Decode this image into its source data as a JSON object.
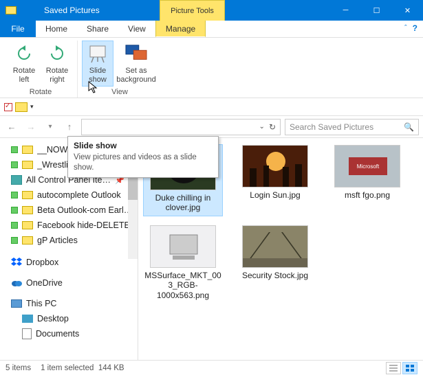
{
  "window": {
    "title": "Saved Pictures",
    "context_tab": "Picture Tools"
  },
  "menu": {
    "file": "File",
    "home": "Home",
    "share": "Share",
    "view": "View",
    "manage": "Manage"
  },
  "ribbon": {
    "rotate_group": "Rotate",
    "view_group": "View",
    "rotate_left": "Rotate left",
    "rotate_right": "Rotate right",
    "slide_show": "Slide show",
    "set_bg": "Set as background"
  },
  "tooltip": {
    "title": "Slide show",
    "body": "View pictures and videos as a slide show."
  },
  "search": {
    "placeholder": "Search Saved Pictures"
  },
  "tree": {
    "items": [
      {
        "label": "__NOW"
      },
      {
        "label": "_Wrestling and MM…"
      },
      {
        "label": "All Control Panel Ite…",
        "icon": "cp"
      },
      {
        "label": "autocomplete Outlook"
      },
      {
        "label": "Beta Outlook-com Earl…"
      },
      {
        "label": "Facebook hide-DELETE"
      },
      {
        "label": "gP Articles"
      }
    ],
    "dropbox": "Dropbox",
    "onedrive": "OneDrive",
    "thispc": "This PC",
    "desktop": "Desktop",
    "documents": "Documents"
  },
  "files": [
    {
      "name": "Duke chilling in clover.jpg",
      "bg": "#2a3a22"
    },
    {
      "name": "Login Sun.jpg",
      "bg": "#5a2d15"
    },
    {
      "name": "msft fgo.png",
      "bg": "#9aa7ae"
    },
    {
      "name": "MSSurface_MKT_003_RGB-1000x563.png",
      "bg": "#e8e8ea"
    },
    {
      "name": "Security Stock.jpg",
      "bg": "#7d7862"
    }
  ],
  "status": {
    "count": "5 items",
    "selection": "1 item selected",
    "size": "144 KB"
  }
}
